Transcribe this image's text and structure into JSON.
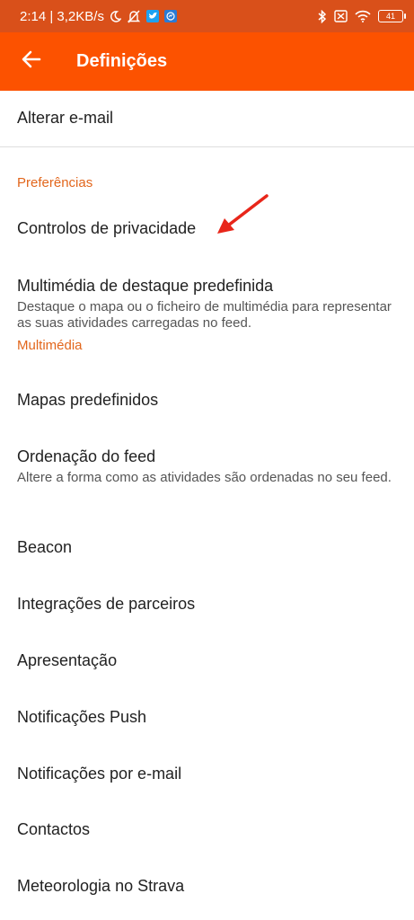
{
  "status_bar": {
    "time_speed": "2:14 | 3,2KB/s",
    "battery": "41",
    "icons": [
      "moon-icon",
      "mute-icon",
      "twitter-icon",
      "messenger-icon",
      "bluetooth-icon",
      "sim-icon",
      "wifi-icon",
      "battery-icon"
    ]
  },
  "app_bar": {
    "title": "Definições",
    "back_icon": "arrow-left-icon"
  },
  "colors": {
    "status_bar": "#d9501a",
    "app_bar": "#fc5200",
    "section": "#e2661c",
    "arrow": "#e8261a"
  },
  "items": {
    "change_email": "Alterar e-mail",
    "section_preferences": "Preferências",
    "privacy_controls": "Controlos de privacidade",
    "default_highlight_media": "Multimédia de destaque predefinida",
    "default_highlight_media_sub": "Destaque o mapa ou o ficheiro de multimédia para representar as suas atividades carregadas no feed.",
    "section_media": "Multimédia",
    "default_maps": "Mapas predefinidos",
    "feed_ordering": "Ordenação do feed",
    "feed_ordering_sub": "Altere a forma como as atividades são ordenadas no seu feed.",
    "beacon": "Beacon",
    "partner_integrations": "Integrações de parceiros",
    "presentation": "Apresentação",
    "push_notifications": "Notificações Push",
    "email_notifications": "Notificações por e-mail",
    "contacts": "Contactos",
    "weather": "Meteorologia no Strava"
  }
}
